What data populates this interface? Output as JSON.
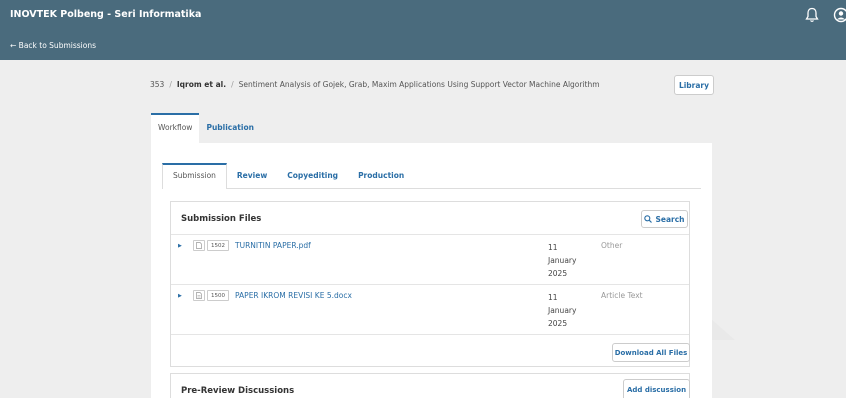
{
  "header": {
    "site_title": "INOVTEK Polbeng - Seri Informatika",
    "back_link": "← Back to Submissions"
  },
  "breadcrumb": {
    "id": "353",
    "author": "Iqrom et al.",
    "title": "Sentiment Analysis of Gojek, Grab, Maxim Applications Using Support Vector Machine Algorithm",
    "separator": "/"
  },
  "library_button": "Library",
  "main_tabs": [
    {
      "label": "Workflow",
      "active": true
    },
    {
      "label": "Publication",
      "active": false
    }
  ],
  "sub_tabs": [
    {
      "label": "Submission",
      "active": true
    },
    {
      "label": "Review",
      "active": false
    },
    {
      "label": "Copyediting",
      "active": false
    },
    {
      "label": "Production",
      "active": false
    }
  ],
  "submission_files": {
    "title": "Submission Files",
    "search_label": "Search",
    "files": [
      {
        "id": "1502",
        "name": "TURNITIN PAPER.pdf",
        "date_day": "11",
        "date_month": "January",
        "date_year": "2025",
        "type": "Other"
      },
      {
        "id": "1500",
        "name": "PAPER IKROM REVISI KE 5.docx",
        "date_day": "11",
        "date_month": "January",
        "date_year": "2025",
        "type": "Article Text"
      }
    ],
    "download_all_label": "Download All Files"
  },
  "discussions": {
    "title": "Pre-Review Discussions",
    "add_label": "Add discussion"
  },
  "colors": {
    "header_bg": "#4a6b7d",
    "link": "#2a6ea6"
  }
}
